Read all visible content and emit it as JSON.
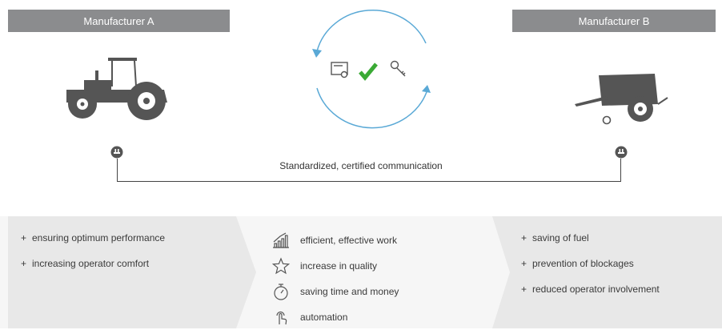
{
  "manufacturer_a": {
    "title": "Manufacturer A",
    "icon": "tractor-icon"
  },
  "manufacturer_b": {
    "title": "Manufacturer B",
    "icon": "baler-icon"
  },
  "certification_cycle": {
    "icons": [
      "certificate-icon",
      "checkmark-icon",
      "key-icon"
    ],
    "arrow_color": "#5aa9d6",
    "check_color": "#3aaa35"
  },
  "communication": {
    "label": "Standardized, certified communication"
  },
  "left_benefits": [
    "ensuring optimum performance",
    "increasing operator comfort"
  ],
  "shared_benefits": [
    {
      "icon": "bar-chart-icon",
      "label": "efficient, effective work"
    },
    {
      "icon": "star-icon",
      "label": "increase in quality"
    },
    {
      "icon": "stopwatch-icon",
      "label": "saving time and money"
    },
    {
      "icon": "touch-hand-icon",
      "label": "automation"
    }
  ],
  "right_benefits": [
    "saving of fuel",
    "prevention of blockages",
    "reduced operator involvement"
  ],
  "colors": {
    "header_bg": "#8b8c8e",
    "machine": "#555555",
    "panel_bg": "#e8e8e8"
  }
}
